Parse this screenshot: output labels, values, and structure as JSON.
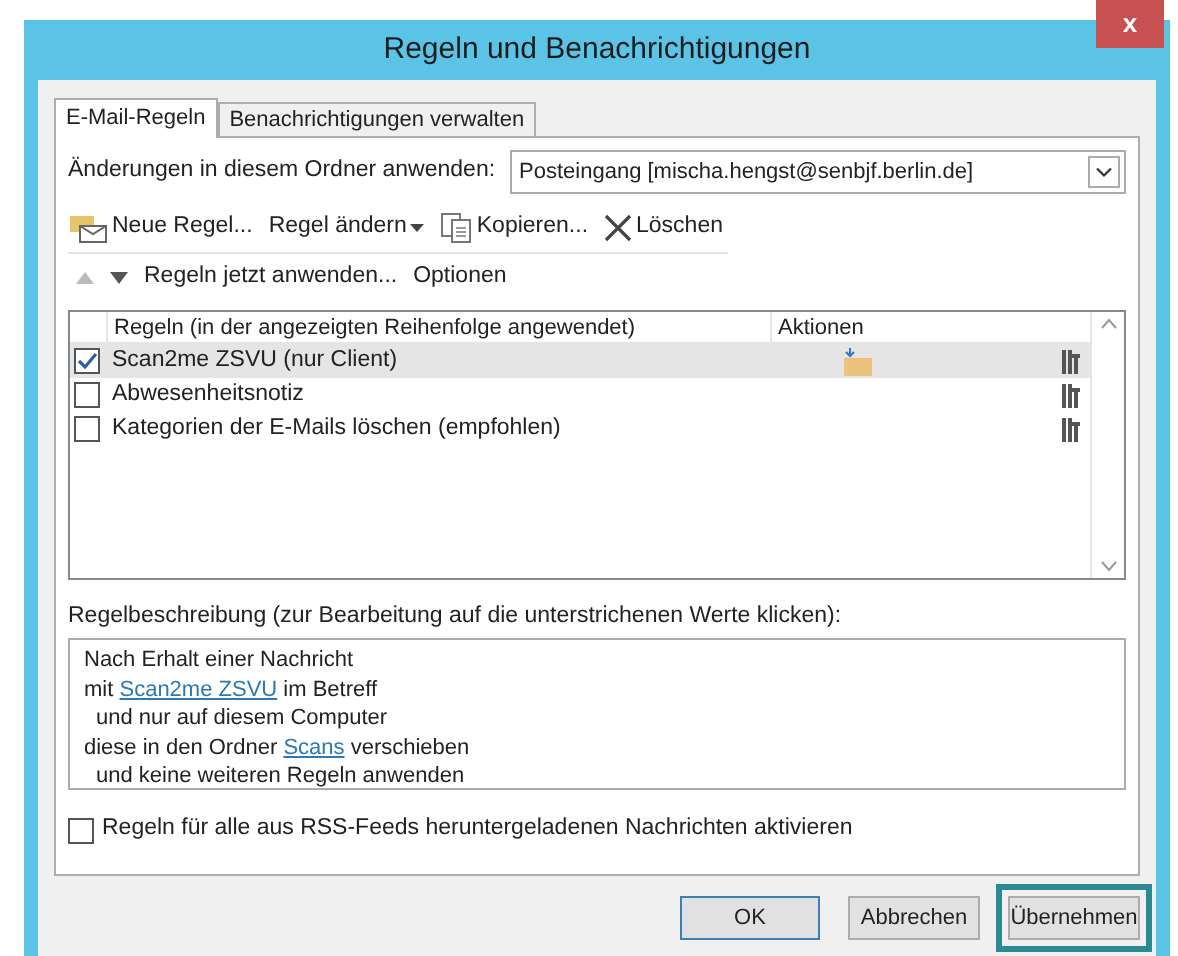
{
  "window": {
    "title": "Regeln und Benachrichtigungen",
    "close": "x"
  },
  "tabs": [
    {
      "label": "E-Mail-Regeln",
      "selected": true
    },
    {
      "label": "Benachrichtigungen verwalten",
      "selected": false
    }
  ],
  "folder": {
    "label": "Änderungen in diesem Ordner anwenden:",
    "value": "Posteingang [mischa.hengst@senbjf.berlin.de]"
  },
  "toolbar": [
    {
      "kind": "new",
      "label": "Neue Regel..."
    },
    {
      "kind": "change",
      "label": "Regel ändern"
    },
    {
      "kind": "copy",
      "label": "Kopieren..."
    },
    {
      "kind": "delete",
      "label": "Löschen"
    }
  ],
  "order_bar": {
    "run": "Regeln jetzt anwenden...",
    "options": "Optionen"
  },
  "rules_table": {
    "columns": [
      "Regeln (in der angezeigten Reihenfolge angewendet)",
      "Aktionen"
    ],
    "rows": [
      {
        "name": "Scan2me ZSVU  (nur Client)",
        "checked": true,
        "selected": true,
        "move_action": true
      },
      {
        "name": "Abwesenheitsnotiz",
        "checked": false,
        "selected": false,
        "move_action": false
      },
      {
        "name": "Kategorien der E-Mails löschen (empfohlen)",
        "checked": false,
        "selected": false,
        "move_action": false
      }
    ]
  },
  "description": {
    "label": "Regelbeschreibung (zur Bearbeitung auf die unterstrichenen Werte klicken):",
    "lines": [
      {
        "indented": false,
        "parts": [
          {
            "text": "Nach Erhalt einer Nachricht",
            "link": false
          }
        ]
      },
      {
        "indented": false,
        "parts": [
          {
            "text": "mit",
            "link": false
          },
          {
            "text": "Scan2me ZSVU",
            "link": true
          },
          {
            "text": "im Betreff",
            "link": false
          }
        ]
      },
      {
        "indented": true,
        "parts": [
          {
            "text": "und nur auf diesem Computer",
            "link": false
          }
        ]
      },
      {
        "indented": false,
        "parts": [
          {
            "text": "diese in den Ordner",
            "link": false
          },
          {
            "text": "Scans",
            "link": true
          },
          {
            "text": "verschieben",
            "link": false
          }
        ]
      },
      {
        "indented": true,
        "parts": [
          {
            "text": "und keine weiteren Regeln anwenden",
            "link": false
          }
        ]
      }
    ]
  },
  "rss": {
    "label": "Regeln für alle aus RSS-Feeds heruntergeladenen Nachrichten aktivieren",
    "checked": false
  },
  "buttons": [
    {
      "label": "OK",
      "default": true,
      "highlighted": false
    },
    {
      "label": "Abbrechen",
      "default": false,
      "highlighted": false
    },
    {
      "label": "Übernehmen",
      "default": false,
      "highlighted": true
    }
  ]
}
